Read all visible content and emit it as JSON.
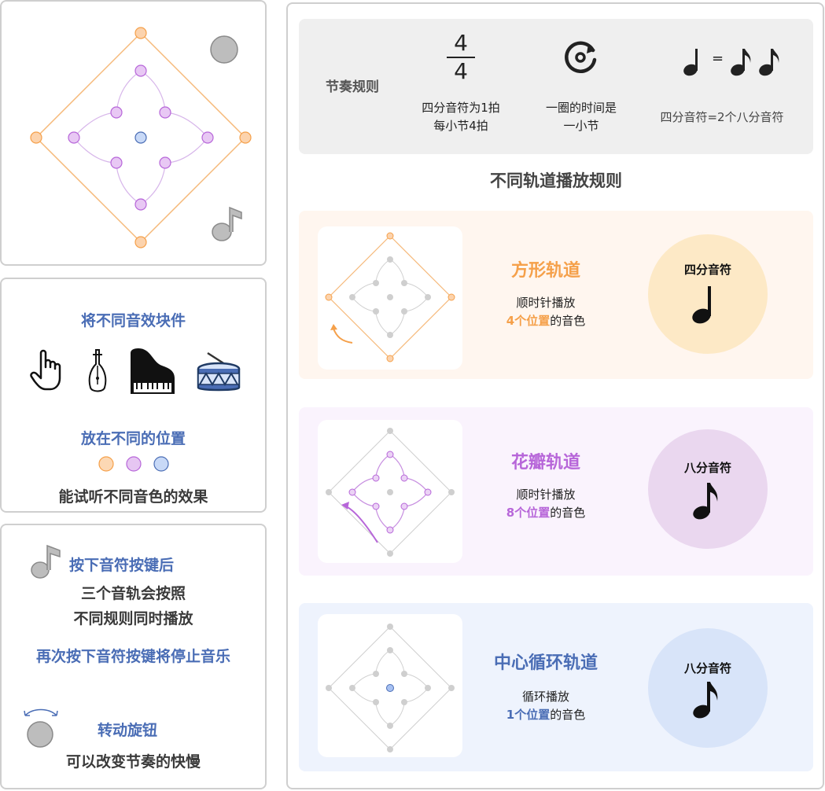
{
  "left_panel": {
    "step1_title": "将不同音效块件",
    "step2_title": "放在不同的位置",
    "step2_desc": "能试听不同音色的效果",
    "step3_title": "按下音符按键后",
    "step3_desc_line1": "三个音轨会按照",
    "step3_desc_line2": "不同规则同时播放",
    "step3_stop": "再次按下音符按键将停止音乐",
    "step4_title": "转动旋钮",
    "step4_desc": "可以改变节奏的快慢"
  },
  "rhythm": {
    "label": "节奏规则",
    "time_sig_top": "4",
    "time_sig_bottom": "4",
    "rule1_line1": "四分音符为1拍",
    "rule1_line2": "每小节4拍",
    "rule2_line1": "一圈的时间是",
    "rule2_line2": "一小节",
    "equals": "=",
    "rule3": "四分音符=2个八分音符"
  },
  "tracks_heading": "不同轨道播放规则",
  "tracks": [
    {
      "title": "方形轨道",
      "line1": "顺时针播放",
      "highlight": "4个位置",
      "suffix": "的音色",
      "note": "四分音符",
      "accent": "#f5a04a",
      "bg": "#fff6ef",
      "circle": "#fde9c6"
    },
    {
      "title": "花瓣轨道",
      "line1": "顺时针播放",
      "highlight": "8个位置",
      "suffix": "的音色",
      "note": "八分音符",
      "accent": "#b766d9",
      "bg": "#faf3fd",
      "circle": "#ead7ef"
    },
    {
      "title": "中心循环轨道",
      "line1": "循环播放",
      "highlight": "1个位置",
      "suffix": "的音色",
      "note": "八分音符",
      "accent": "#4a6db5",
      "bg": "#eef3fd",
      "circle": "#d8e4f9"
    }
  ],
  "colors": {
    "orange": "#f5a04a",
    "purple": "#b766d9",
    "blue": "#4a6db5",
    "dot_orange": "#fcd8b4",
    "dot_purple": "#e6c6f2",
    "dot_blue": "#c8d9f7"
  },
  "icons": [
    "knob-icon",
    "music-note-icon",
    "hand-pointer-icon",
    "pipa-icon",
    "piano-icon",
    "drum-icon",
    "loop-icon"
  ]
}
